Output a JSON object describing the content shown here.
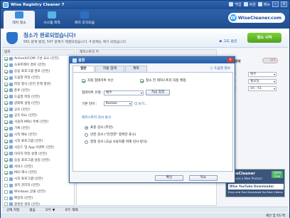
{
  "window": {
    "title": "Wise Registry Cleaner 7",
    "menu": [
      "백업",
      "복원",
      "메뉴"
    ]
  },
  "toolbar": {
    "tabs": [
      {
        "label": "레지 청소",
        "color": "#3d8bd9"
      },
      {
        "label": "시스템 최적",
        "color": "#55b4e8"
      },
      {
        "label": "레지 조각모음",
        "color": "#2f6fc2"
      }
    ],
    "logo": "WiseCleaner.com"
  },
  "banner": {
    "title": "청소가 완료되었습니다!",
    "subtitle": "561 문제 발견, 547 문제가 해결되었습니다. 4 문제는 제거 되었습니다.",
    "advanced_link": "▶ 고도 옵션",
    "scan_button": "청소 시작"
  },
  "left_panel": {
    "header": "범위",
    "items": [
      {
        "label": "ActiveX/COM 구성 요소 (안전)",
        "checked": true
      },
      {
        "label": "소프트웨어 경로 (안전)",
        "checked": true
      },
      {
        "label": "응용 프로그램 경로 (안전)",
        "checked": true
      },
      {
        "label": "도움말 파일 (안전)",
        "checked": true
      },
      {
        "label": "파일 형식 (안전 문제 발견)",
        "checked": true
      },
      {
        "label": "폰트 (안전)",
        "checked": true
      },
      {
        "label": "도움말 파일 (안전)",
        "checked": true
      },
      {
        "label": "방화벽 설정 (안전)",
        "checked": true
      },
      {
        "label": "공유 (안전)",
        "checked": true
      },
      {
        "label": "공유 DLL (안전)",
        "checked": true
      },
      {
        "label": "사용자 MRU 목록 (안전)",
        "checked": true
      },
      {
        "label": "기록 (안전)",
        "checked": true
      },
      {
        "label": "시작 메뉴 (안전)",
        "checked": true
      },
      {
        "label": "시작 프로그램 (안전)",
        "checked": true
      },
      {
        "label": "사운드 및 App 이벤트 (안전)",
        "checked": true
      },
      {
        "label": "이미지 파일 실행 (안전)",
        "checked": true
      },
      {
        "label": "응용 프로그램 설정 (안전)",
        "checked": true
      },
      {
        "label": "서비스 (안전)",
        "checked": true
      },
      {
        "label": "MUI 캐시 (안전)",
        "checked": true
      },
      {
        "label": "시작 프로그램 (안전)",
        "checked": false
      },
      {
        "label": "설치 관리자 (안전)",
        "checked": false
      },
      {
        "label": "Windows 글꼴 (안전)",
        "checked": false
      },
      {
        "label": "확장자 (안전)",
        "checked": false
      },
      {
        "label": "잘못된 경로 (안전)",
        "checked": false
      }
    ]
  },
  "middle_panel": {
    "header": "레지스트리 키"
  },
  "right_panel": {
    "timer_label": "예약",
    "toggle": "OFF",
    "fields": [
      {
        "label": "실행 방식 :",
        "value": "매주"
      },
      {
        "label": "날짜 선택 :",
        "value": "월요일"
      },
      {
        "label": "시간 선택 :",
        "value": "16 : 51"
      }
    ]
  },
  "ad": {
    "brand": "WiseCleaner",
    "tagline": "Releases a New Product",
    "product": "Wise YouTube Downloader",
    "desc": "Easy and Fast Download YouTube Videos",
    "badge": "100% Free"
  },
  "bottom_bar": {
    "items": [
      "선택 지정",
      "없음",
      "모두 ▼",
      "모두 해제"
    ]
  },
  "status_bar": {
    "text": "제안 및 피드백"
  },
  "dialog": {
    "title": "설정",
    "tabs": [
      "일반",
      "자동 업데",
      "제외"
    ],
    "help_link": "도움말 정보",
    "checkbox1": "자동 업데이트 수신",
    "checkbox2": "청소 전 레지스트리 자동 백업",
    "update_label": "업데이트 유형 :",
    "update_value": "매주",
    "update_button": "지금 점검",
    "language_label": "기본 언어 :",
    "language_value": "Korean",
    "language_more": "더 보기...",
    "section_title": "레지스트리 검사 방식",
    "radios": [
      {
        "label": "표준 검사 (추천)",
        "selected": true
      },
      {
        "label": "안전 검사 (\"안전한\" 항목만 표시)",
        "selected": false
      },
      {
        "label": "정밀 검사 (고급 사용자를 위해 검사 방식)",
        "selected": false
      }
    ],
    "ok": "확인",
    "cancel": "취소"
  }
}
